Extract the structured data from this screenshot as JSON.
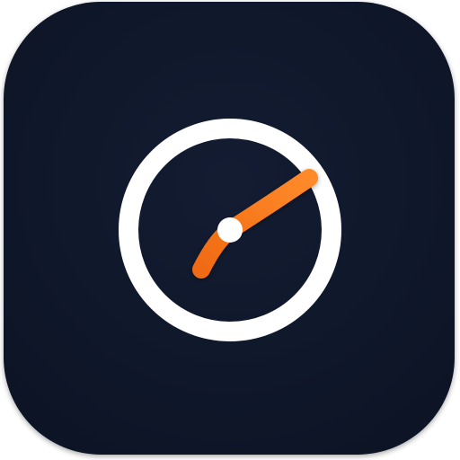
{
  "icon": {
    "name": "speedometer-icon",
    "colors": {
      "tile": "#0f172a",
      "ring": "#ffffff",
      "needle": "#f97316",
      "needle_highlight": "#fb923c",
      "hub": "#ffffff"
    }
  }
}
